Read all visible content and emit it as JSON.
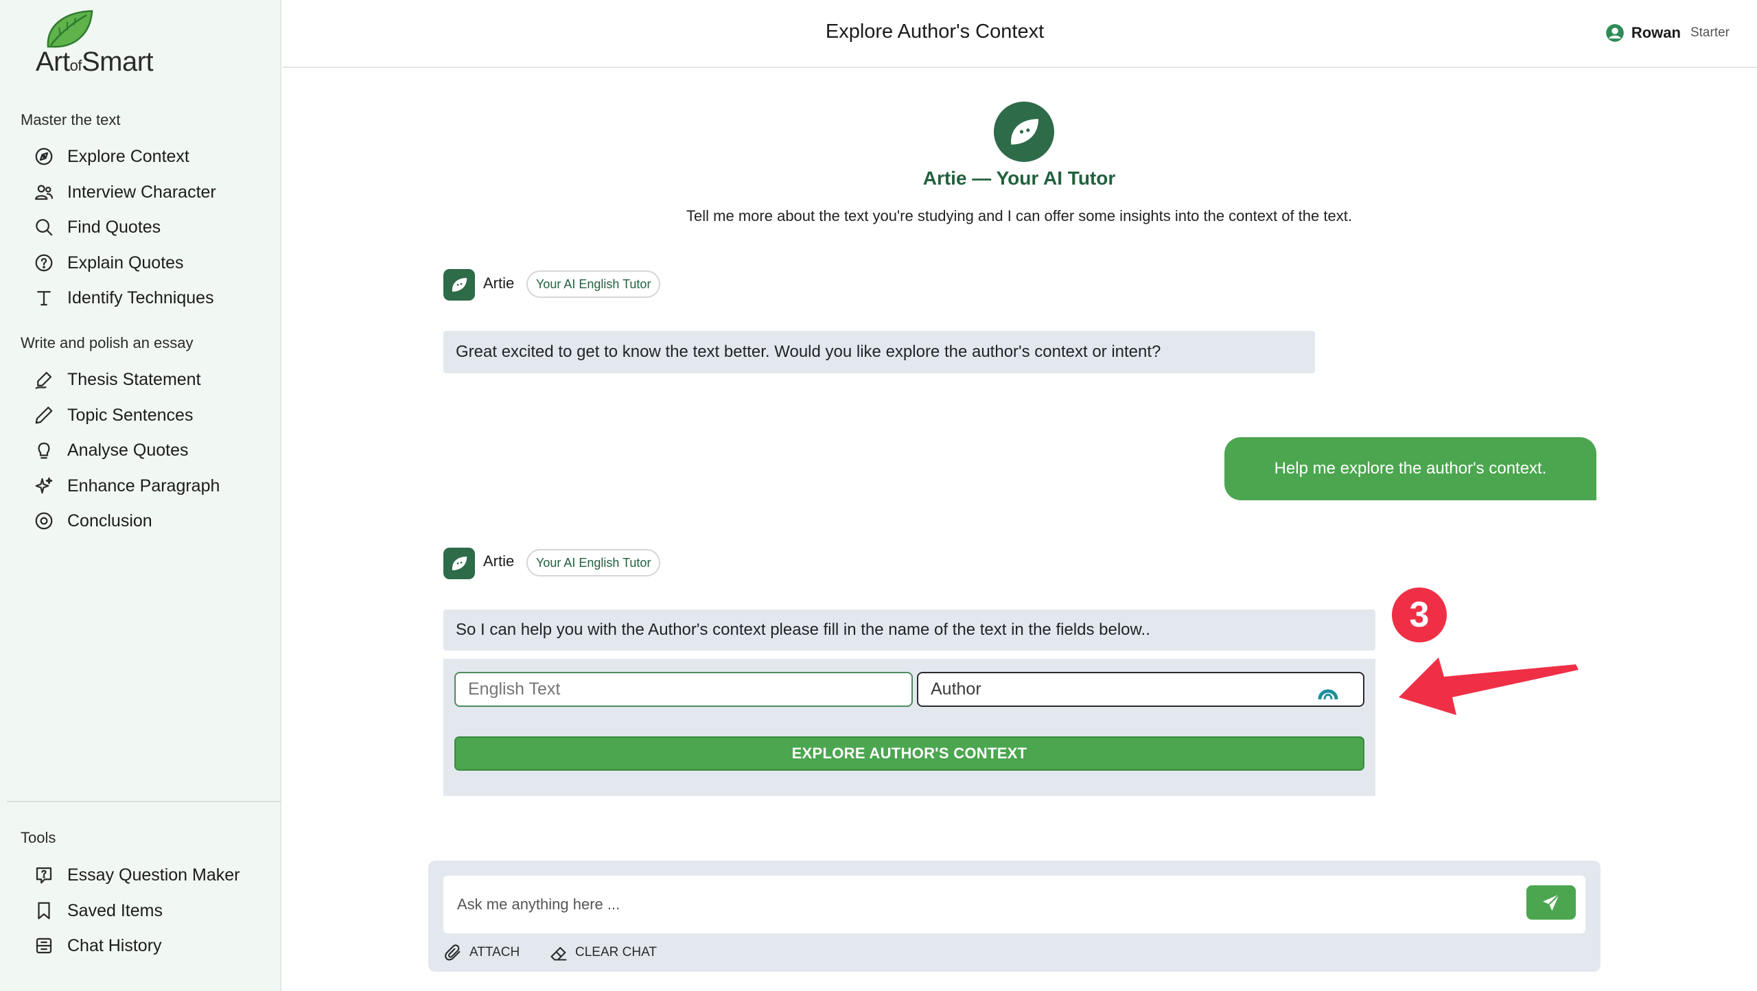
{
  "brand": {
    "logo_main": "Art",
    "logo_of": "of",
    "logo_end": "Smart"
  },
  "sidebar": {
    "sections": [
      {
        "title": "Master the text",
        "items": [
          {
            "label": "Explore Context",
            "icon": "compass-icon"
          },
          {
            "label": "Interview Character",
            "icon": "users-icon"
          },
          {
            "label": "Find Quotes",
            "icon": "search-icon"
          },
          {
            "label": "Explain Quotes",
            "icon": "question-circle-icon"
          },
          {
            "label": "Identify Techniques",
            "icon": "text-type-icon"
          }
        ]
      },
      {
        "title": "Write and polish an essay",
        "items": [
          {
            "label": "Thesis Statement",
            "icon": "signature-pen-icon"
          },
          {
            "label": "Topic Sentences",
            "icon": "pencil-icon"
          },
          {
            "label": "Analyse Quotes",
            "icon": "lightbulb-icon"
          },
          {
            "label": "Enhance Paragraph",
            "icon": "sparkles-icon"
          },
          {
            "label": "Conclusion",
            "icon": "target-circle-icon"
          }
        ]
      },
      {
        "title": "Tools",
        "items": [
          {
            "label": "Essay Question Maker",
            "icon": "message-question-icon"
          },
          {
            "label": "Saved Items",
            "icon": "bookmark-icon"
          },
          {
            "label": "Chat History",
            "icon": "archive-icon"
          }
        ]
      }
    ]
  },
  "header": {
    "title": "Explore Author's Context",
    "user_name": "Rowan",
    "user_plan": "Starter"
  },
  "intro": {
    "title": "Artie — Your AI Tutor",
    "description": "Tell me more about the text you're studying and I can offer some insights into the context of the text."
  },
  "messages": [
    {
      "sender": "Artie",
      "badge": "Your AI English Tutor",
      "text": "Great excited to get to know the text better. Would you like explore the author's context or intent?"
    },
    {
      "sender": "user",
      "text": "Help me explore the author's context."
    },
    {
      "sender": "Artie",
      "badge": "Your AI English Tutor",
      "text": "So I can help you with the Author's context please fill in the name of the text in the fields below.."
    }
  ],
  "form": {
    "english_text_placeholder": "English Text",
    "author_placeholder": "Author",
    "submit_label": "EXPLORE AUTHOR'S CONTEXT"
  },
  "annotation": {
    "step_number": "3"
  },
  "chat": {
    "placeholder": "Ask me anything here ...",
    "attach_label": "ATTACH",
    "clear_label": "CLEAR CHAT"
  },
  "colors": {
    "brand_green": "#2e6b48",
    "button_green": "#4ba64f",
    "sidebar_bg": "#f1f7f2",
    "bubble_bg": "#e3e8ef",
    "annotation_red": "#ef2f46"
  }
}
